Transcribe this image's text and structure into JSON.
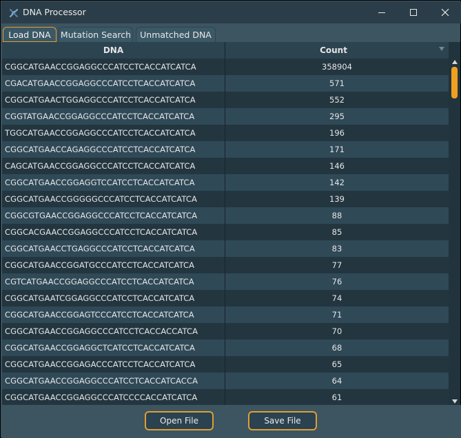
{
  "window": {
    "title": "DNA Processor"
  },
  "tabs": [
    {
      "label": "Load DNA",
      "active": true
    },
    {
      "label": "Mutation Search",
      "active": false
    },
    {
      "label": "Unmatched DNA",
      "active": false
    }
  ],
  "table": {
    "columns": [
      "DNA",
      "Count"
    ],
    "rows": [
      {
        "dna": "CGGCATGAACCGGAGGCCCATCCTCACCATCATCA",
        "count": "358904"
      },
      {
        "dna": "CGACATGAACCGGAGGCCCATCCTCACCATCATCA",
        "count": "571"
      },
      {
        "dna": "CGGCATGAACTGGAGGCCCATCCTCACCATCATCA",
        "count": "552"
      },
      {
        "dna": "CGGTATGAACCGGAGGCCCATCCTCACCATCATCA",
        "count": "295"
      },
      {
        "dna": "TGGCATGAACCGGAGGCCCATCCTCACCATCATCA",
        "count": "196"
      },
      {
        "dna": "CGGCATGAACCAGAGGCCCATCCTCACCATCATCA",
        "count": "171"
      },
      {
        "dna": "CAGCATGAACCGGAGGCCCATCCTCACCATCATCA",
        "count": "146"
      },
      {
        "dna": "CGGCATGAACCGGAGGTCCATCCTCACCATCATCA",
        "count": "142"
      },
      {
        "dna": "CGGCATGAACCGGGGGCCCATCCTCACCATCATCA",
        "count": "139"
      },
      {
        "dna": "CGGCGTGAACCGGAGGCCCATCCTCACCATCATCA",
        "count": "88"
      },
      {
        "dna": "CGGCACGAACCGGAGGCCCATCCTCACCATCATCA",
        "count": "85"
      },
      {
        "dna": "CGGCATGAACCTGAGGCCCATCCTCACCATCATCA",
        "count": "83"
      },
      {
        "dna": "CGGCATGAACCGGATGCCCATCCTCACCATCATCA",
        "count": "77"
      },
      {
        "dna": "CGTCATGAACCGGAGGCCCATCCTCACCATCATCA",
        "count": "76"
      },
      {
        "dna": "CGGCATGAATCGGAGGCCCATCCTCACCATCATCA",
        "count": "74"
      },
      {
        "dna": "CGGCATGAACCGGAGTCCCATCCTCACCATCATCA",
        "count": "71"
      },
      {
        "dna": "CGGCATGAACCGGAGGCCCATCCTCACCACCATCA",
        "count": "70"
      },
      {
        "dna": "CGGCATGAACCGGAGGCTCATCCTCACCATCATCA",
        "count": "68"
      },
      {
        "dna": "CGGCATGAACCGGAGACCCATCCTCACCATCATCA",
        "count": "65"
      },
      {
        "dna": "CGGCATGAACCGGAGGCCCATCCTCACCATCACCA",
        "count": "64"
      },
      {
        "dna": "CGGCATGAACCGGAGGCCCATCCCCACCATCATCA",
        "count": "61"
      }
    ]
  },
  "buttons": {
    "open": "Open File",
    "save": "Save File"
  },
  "icons": {
    "app": "dna-app-icon",
    "minimize": "minimize-icon",
    "maximize": "maximize-icon",
    "close": "close-icon",
    "sort": "sort-arrow-icon"
  },
  "colors": {
    "accent": "#e0a030",
    "row_dark": "#233640",
    "row_light": "#2f4957"
  }
}
